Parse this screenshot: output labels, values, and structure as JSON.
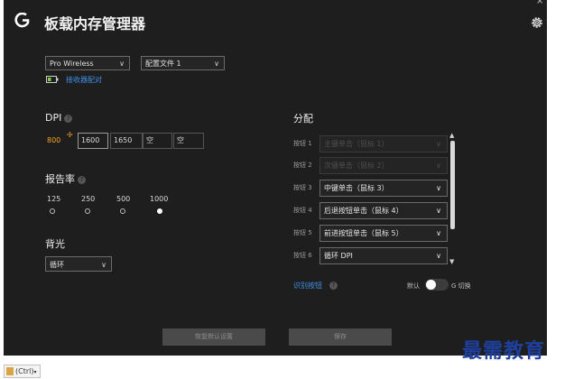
{
  "header": {
    "title": "板载内存管理器",
    "close_glyph": "×"
  },
  "device": {
    "selected": "Pro Wireless",
    "profile": "配置文件 1",
    "pair_label": "接收器配对"
  },
  "dpi": {
    "label": "DPI",
    "values": [
      "800",
      "1600",
      "1650",
      "空",
      "空"
    ],
    "active_color": "#f5a623"
  },
  "report_rate": {
    "label": "报告率",
    "options": [
      "125",
      "250",
      "500",
      "1000"
    ],
    "selected": "1000"
  },
  "backlight": {
    "label": "背光",
    "mode": "循环"
  },
  "assignments": {
    "title": "分配",
    "rows": [
      {
        "label": "按钮 1",
        "value": "主键单击（鼠标 1）"
      },
      {
        "label": "按钮 2",
        "value": "次键单击（鼠标 2）"
      },
      {
        "label": "按钮 3",
        "value": "中键单击（鼠标 3）"
      },
      {
        "label": "按钮 4",
        "value": "后退按钮单击（鼠标 4）"
      },
      {
        "label": "按钮 5",
        "value": "前进按钮单击（鼠标 5）"
      },
      {
        "label": "按钮 6",
        "value": "循环 DPI"
      }
    ],
    "identify_link": "识别按钮",
    "default_label": "默认",
    "gshift_label": "G 切换"
  },
  "footer": {
    "restore_label": "恢复默认设置",
    "save_label": "保存"
  },
  "watermark": "最需教育",
  "shortcut_label": "(Ctrl)"
}
